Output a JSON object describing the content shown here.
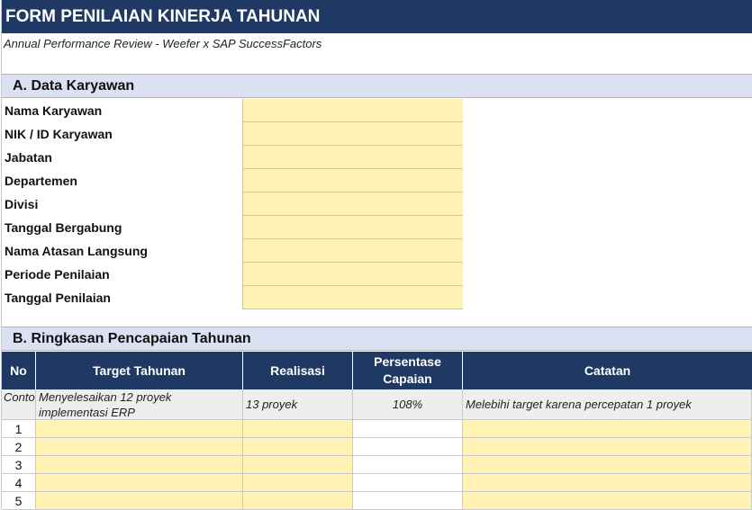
{
  "title": "FORM PENILAIAN KINERJA TAHUNAN",
  "subtitle": "Annual Performance Review - Weefer x SAP SuccessFactors",
  "section_a": {
    "heading": "A. Data Karyawan",
    "fields": [
      {
        "label": "Nama Karyawan",
        "value": ""
      },
      {
        "label": "NIK / ID Karyawan",
        "value": ""
      },
      {
        "label": "Jabatan",
        "value": ""
      },
      {
        "label": "Departemen",
        "value": ""
      },
      {
        "label": "Divisi",
        "value": ""
      },
      {
        "label": "Tanggal Bergabung",
        "value": ""
      },
      {
        "label": "Nama Atasan Langsung",
        "value": ""
      },
      {
        "label": "Periode Penilaian",
        "value": ""
      },
      {
        "label": "Tanggal Penilaian",
        "value": ""
      }
    ]
  },
  "section_b": {
    "heading": "B. Ringkasan Pencapaian Tahunan",
    "columns": [
      "No",
      "Target Tahunan",
      "Realisasi",
      "Persentase Capaian",
      "Catatan"
    ],
    "example": {
      "no": "Contoh",
      "target": "Menyelesaikan 12 proyek implementasi ERP",
      "realisasi": "13 proyek",
      "persentase": "108%",
      "catatan": "Melebihi target karena percepatan 1 proyek"
    },
    "rows": [
      "1",
      "2",
      "3",
      "4",
      "5"
    ]
  },
  "colors": {
    "header_bg": "#1f3864",
    "section_bg": "#d9e1f2",
    "input_bg": "#fff2b2",
    "example_bg": "#eeeeee"
  }
}
